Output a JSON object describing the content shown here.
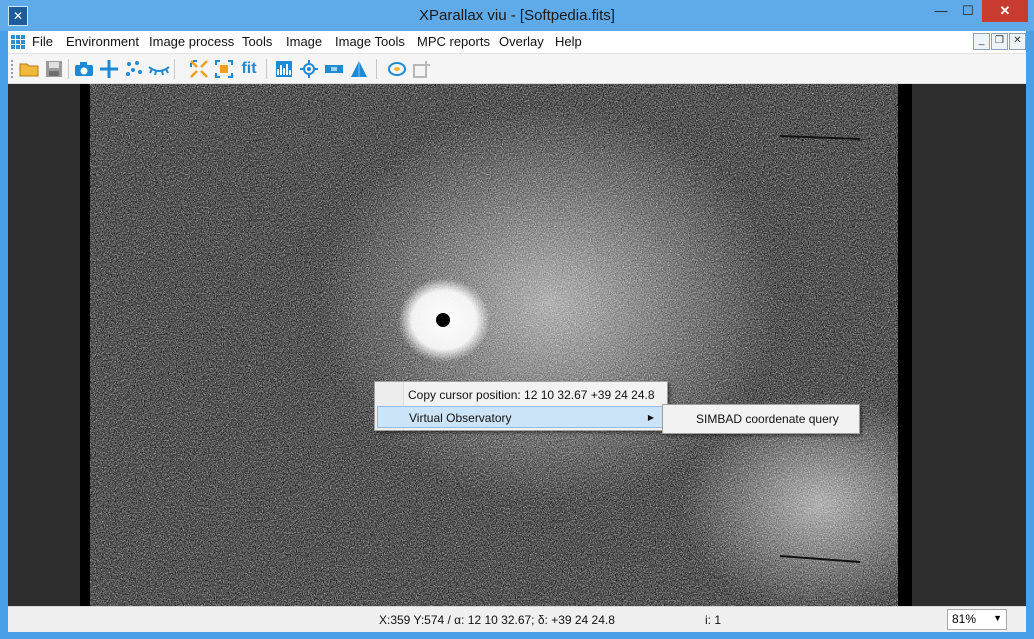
{
  "window": {
    "title": "XParallax viu - [Softpedia.fits]"
  },
  "title_icons": {
    "app": "xparallax-app-icon",
    "minimize": "minimize-icon",
    "maximize": "maximize-icon",
    "close": "close-icon"
  },
  "menubar": {
    "items": [
      "File",
      "Environment",
      "Image process",
      "Tools",
      "Image",
      "Image Tools",
      "MPC reports",
      "Overlay",
      "Help"
    ]
  },
  "toolbar": {
    "buttons": [
      "open-folder-icon",
      "save-icon",
      "camera-icon",
      "crosshair-icon",
      "star-field-icon",
      "eye-icon",
      "zoom-expand-icon",
      "zoom-frame-icon",
      "fit-icon",
      "histogram-icon",
      "target-icon",
      "measure-icon",
      "triangle-icon",
      "spiral-icon",
      "add-layer-icon"
    ],
    "fit_label": "fit"
  },
  "colors": {
    "accent": "#2b8fd6",
    "titlebar": "#5fabea",
    "close": "#c73c2e",
    "highlight": "#cce4f7"
  },
  "context_menu": {
    "items": [
      {
        "label": "Copy cursor position: 12 10 32.67 +39 24 24.8"
      },
      {
        "label": "Virtual Observatory",
        "submenu": true
      }
    ],
    "submenu_items": [
      "SIMBAD coordenate query"
    ]
  },
  "statusbar": {
    "coords": "X:359 Y:574 / α: 12 10 32.67; δ: +39 24 24.8",
    "index": "i: 1",
    "zoom": "81%"
  }
}
